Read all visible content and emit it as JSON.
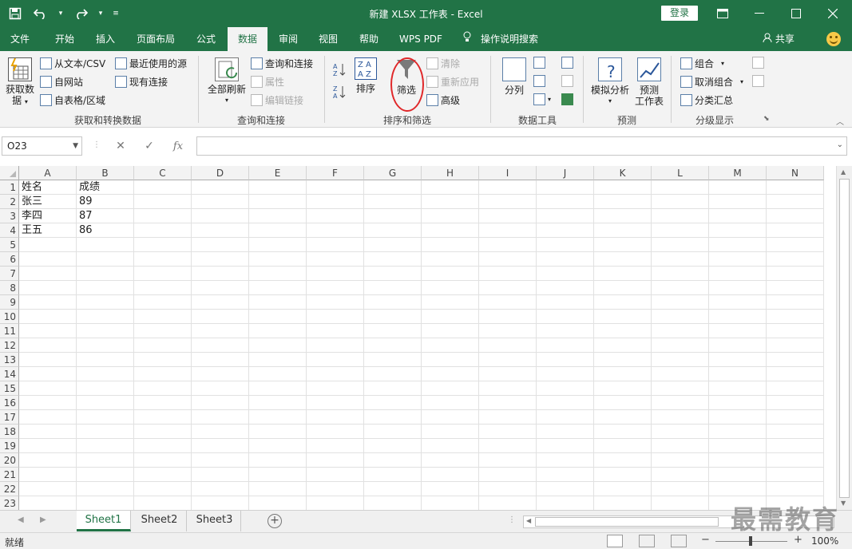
{
  "titlebar": {
    "title": "新建 XLSX 工作表  -  Excel",
    "login": "登录",
    "qat": {
      "save_icon": "save-icon",
      "undo_icon": "undo-icon",
      "redo_icon": "redo-icon"
    }
  },
  "tabs": [
    "文件",
    "开始",
    "插入",
    "页面布局",
    "公式",
    "数据",
    "审阅",
    "视图",
    "帮助",
    "WPS PDF",
    "操作说明搜索"
  ],
  "active_tab": "数据",
  "share": "共享",
  "ribbon": {
    "get_data": {
      "label_line1": "获取数",
      "label_line2": "据"
    },
    "from_text_csv": "从文本/CSV",
    "from_web": "自网站",
    "from_table": "自表格/区域",
    "recent_sources": "最近使用的源",
    "existing_connections": "现有连接",
    "group1": "获取和转换数据",
    "refresh_all": "全部刷新",
    "queries_connections": "查询和连接",
    "properties": "属性",
    "edit_links": "编辑链接",
    "group2": "查询和连接",
    "sort": "排序",
    "filter": "筛选",
    "clear": "清除",
    "reapply": "重新应用",
    "advanced": "高级",
    "group3": "排序和筛选",
    "text_to_columns": "分列",
    "group4": "数据工具",
    "what_if": "模拟分析",
    "forecast_line1": "预测",
    "forecast_line2": "工作表",
    "group5": "预测",
    "group_cmd": "组合",
    "ungroup": "取消组合",
    "subtotal": "分类汇总",
    "group6": "分级显示"
  },
  "formula_bar": {
    "name_box": "O23",
    "formula": ""
  },
  "columns": [
    "A",
    "B",
    "C",
    "D",
    "E",
    "F",
    "G",
    "H",
    "I",
    "J",
    "K",
    "L",
    "M",
    "N"
  ],
  "rows": [
    "1",
    "2",
    "3",
    "4",
    "5",
    "6",
    "7",
    "8",
    "9",
    "10",
    "11",
    "12",
    "13",
    "14",
    "15",
    "16",
    "17",
    "18",
    "19",
    "20",
    "21",
    "22",
    "23"
  ],
  "cells": {
    "A1": "姓名",
    "B1": "成绩",
    "A2": "张三",
    "B2": "89",
    "A3": "李四",
    "B3": "87",
    "A4": "王五",
    "B4": "86"
  },
  "sheets": [
    "Sheet1",
    "Sheet2",
    "Sheet3"
  ],
  "active_sheet": "Sheet1",
  "status": "就绪",
  "zoom": "100%",
  "watermark": "最需教育",
  "colors": {
    "excel_green": "#217346",
    "highlight_circle": "#e0282a"
  }
}
